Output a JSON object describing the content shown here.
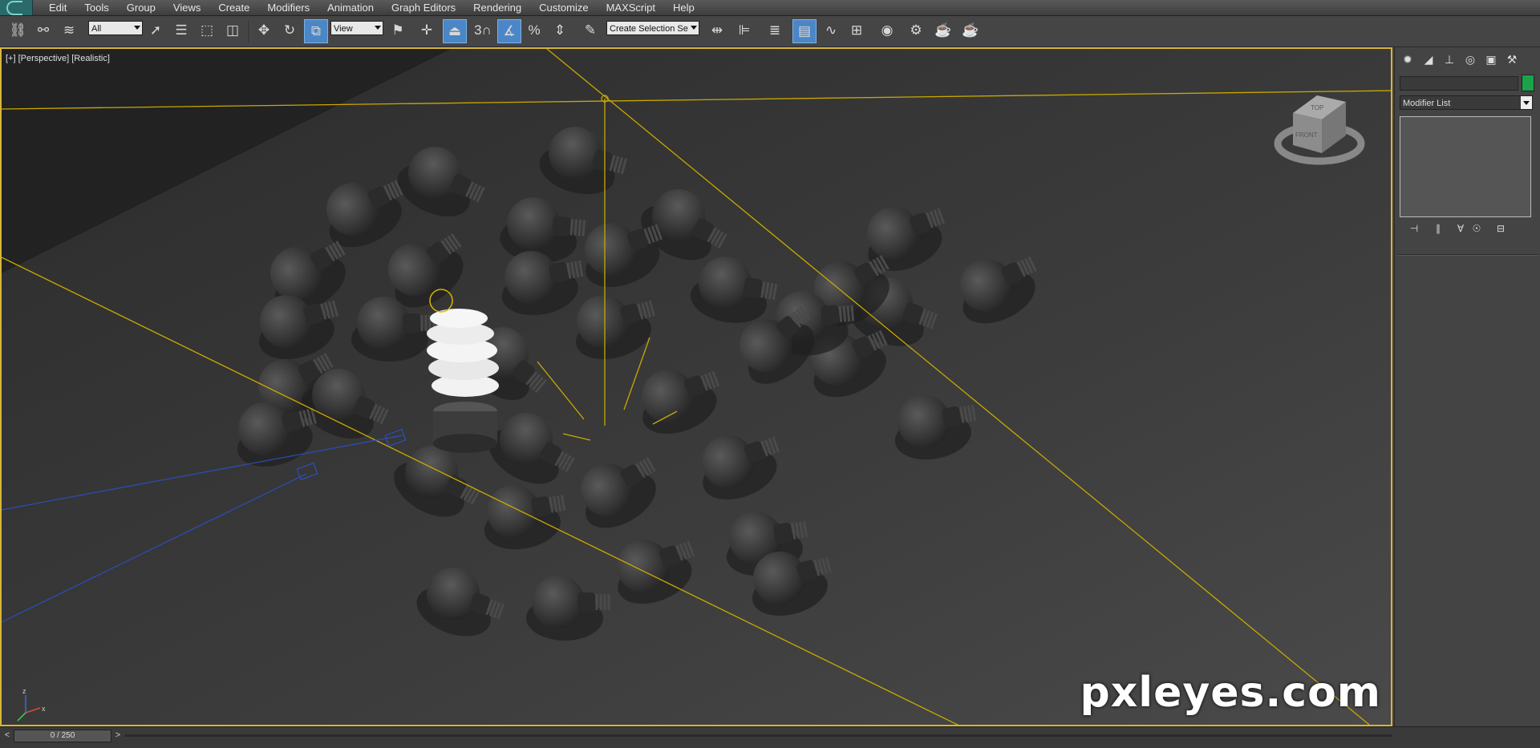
{
  "menu": {
    "items": [
      "Edit",
      "Tools",
      "Group",
      "Views",
      "Create",
      "Modifiers",
      "Animation",
      "Graph Editors",
      "Rendering",
      "Customize",
      "MAXScript",
      "Help"
    ]
  },
  "toolbar": {
    "selection_filter": "All",
    "reference_coordinate": "View",
    "snap_toggle_label": "3",
    "named_selection_placeholder": "Create Selection Se"
  },
  "viewport": {
    "label": "[+] [Perspective] [Realistic]",
    "viewcube": {
      "top": "TOP",
      "front": "FRONT"
    },
    "watermark": "pxleyes.com",
    "axis_labels": {
      "z": "z",
      "x": "x"
    }
  },
  "command_panel": {
    "modifier_list_label": "Modifier List"
  },
  "timeline": {
    "frame_display": "0 / 250",
    "prev": "<",
    "next": ">"
  },
  "colors": {
    "selection_border": "#d7b53a",
    "active_tool": "#4b86c6",
    "object_color": "#1aa34a",
    "light_lines": "#c9a800",
    "camera_lines": "#2a4fbf"
  },
  "icons": [
    "select-link-icon",
    "unlink-icon",
    "bind-space-warp-icon",
    "select-object-icon",
    "select-by-name-icon",
    "rectangular-selection-icon",
    "window-crossing-icon",
    "move-icon",
    "rotate-icon",
    "scale-icon",
    "use-pivot-icon",
    "select-manipulate-icon",
    "keyboard-shortcut-icon",
    "snap-icon",
    "angle-snap-icon",
    "percent-snap-icon",
    "spinner-snap-icon",
    "edit-named-selection-icon",
    "mirror-icon",
    "align-icon",
    "layer-manager-icon",
    "graphite-ribbon-icon",
    "curve-editor-icon",
    "schematic-view-icon",
    "material-editor-icon",
    "render-setup-icon",
    "rendered-frame-icon",
    "render-production-icon"
  ]
}
